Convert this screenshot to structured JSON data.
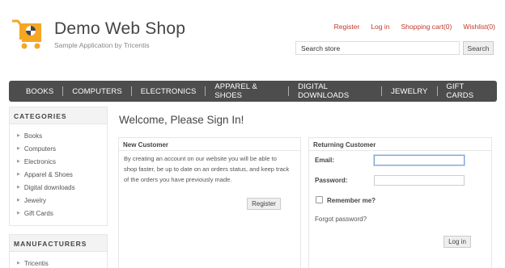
{
  "header": {
    "title": "Demo Web Shop",
    "subtitle": "Sample Application by Tricentis",
    "links": [
      "Register",
      "Log in",
      "Shopping cart(0)",
      "Wishlist(0)"
    ],
    "search_placeholder": "Search store",
    "search_button": "Search",
    "accent_color": "#c0392b",
    "logo_color": "#f5a623"
  },
  "menu": [
    "BOOKS",
    "COMPUTERS",
    "ELECTRONICS",
    "APPAREL & SHOES",
    "DIGITAL DOWNLOADS",
    "JEWELRY",
    "GIFT CARDS"
  ],
  "sidebar": {
    "categories_title": "CATEGORIES",
    "categories": [
      "Books",
      "Computers",
      "Electronics",
      "Apparel & Shoes",
      "Digital downloads",
      "Jewelry",
      "Gift Cards"
    ],
    "manufacturers_title": "MANUFACTURERS",
    "manufacturers": [
      "Tricentis"
    ]
  },
  "main": {
    "page_title": "Welcome, Please Sign In!",
    "new_customer": {
      "title": "New Customer",
      "description": "By creating an account on our website you will be able to shop faster, be up to date on an orders status, and keep track of the orders you have previously made.",
      "register_button": "Register"
    },
    "returning_customer": {
      "title": "Returning Customer",
      "email_label": "Email:",
      "email_value": "",
      "password_label": "Password:",
      "password_value": "",
      "remember_label": "Remember me?",
      "remember_checked": false,
      "forgot_link": "Forgot password?",
      "login_button": "Log in"
    }
  }
}
